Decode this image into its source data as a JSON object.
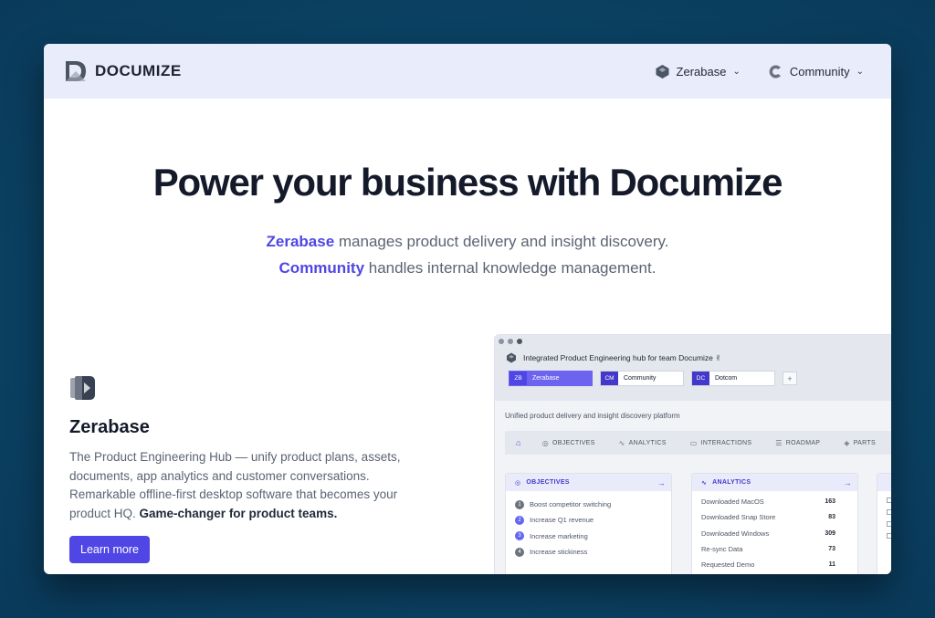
{
  "header": {
    "brand": "DOCUMIZE",
    "nav": [
      {
        "label": "Zerabase"
      },
      {
        "label": "Community"
      }
    ]
  },
  "hero": {
    "title": "Power your business with Documize",
    "line1_product": "Zerabase",
    "line1_text": " manages product delivery and insight discovery.",
    "line2_product": "Community",
    "line2_text": " handles internal knowledge management."
  },
  "feature": {
    "title": "Zerabase",
    "body": "The Product Engineering Hub — unify product plans, assets, documents, app analytics and customer conversations. Remarkable offline-first desktop software that becomes your product HQ. ",
    "emphasis": "Game-changer for product teams.",
    "button": "Learn more"
  },
  "app": {
    "title": "Integrated Product Engineering hub for team Documize ✌",
    "tabs": [
      {
        "code": "ZB",
        "label": "Zerabase"
      },
      {
        "code": "CM",
        "label": "Community"
      },
      {
        "code": "DC",
        "label": "Dotcom"
      }
    ],
    "add_tab": "+",
    "description": "Unified product delivery and insight discovery platform",
    "sections": [
      "OBJECTIVES",
      "ANALYTICS",
      "INTERACTIONS",
      "ROADMAP",
      "PARTS"
    ],
    "objectives": {
      "title": "OBJECTIVES",
      "items": [
        {
          "n": "1",
          "label": "Boost competitor switching"
        },
        {
          "n": "2",
          "label": "Increase Q1 revenue"
        },
        {
          "n": "3",
          "label": "Increase marketing"
        },
        {
          "n": "4",
          "label": "Increase stickiness"
        }
      ]
    },
    "analytics": {
      "title": "ANALYTICS",
      "items": [
        {
          "label": "Downloaded MacOS",
          "value": "163"
        },
        {
          "label": "Downloaded Snap Store",
          "value": "83"
        },
        {
          "label": "Downloaded Windows",
          "value": "309"
        },
        {
          "label": "Re-sync Data",
          "value": "73"
        },
        {
          "label": "Requested Demo",
          "value": "11"
        }
      ]
    }
  },
  "colors": {
    "accent": "#4f46e5",
    "background": "#0c4a6e",
    "header_bg": "#e8ecfb"
  }
}
